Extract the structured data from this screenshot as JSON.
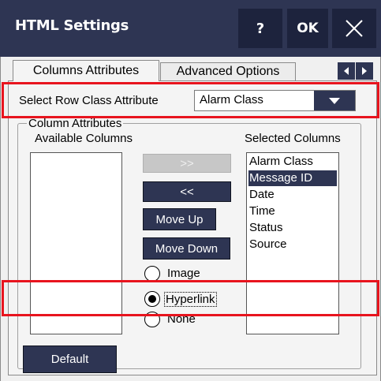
{
  "window": {
    "title": "HTML Settings",
    "help_label": "?",
    "ok_label": "OK"
  },
  "tabs": [
    {
      "label": "Columns Attributes",
      "active": true
    },
    {
      "label": "Advanced Options",
      "active": false
    }
  ],
  "row_class": {
    "label": "Select Row Class Attribute",
    "value": "Alarm Class"
  },
  "column_attributes": {
    "group_label": "Column Attributes",
    "available_label": "Available Columns",
    "selected_label": "Selected Columns",
    "available_items": [],
    "selected_items": [
      "Alarm Class",
      "Message ID",
      "Date",
      "Time",
      "Status",
      "Source"
    ],
    "selected_highlight": "Message ID"
  },
  "buttons": {
    "add": ">>",
    "remove": "<<",
    "move_up": "Move Up",
    "move_down": "Move Down",
    "default": "Default"
  },
  "radio_options": [
    {
      "label": "Image",
      "checked": false
    },
    {
      "label": "Hyperlink",
      "checked": true
    },
    {
      "label": "None",
      "checked": false
    }
  ],
  "colors": {
    "accent": "#2e3553",
    "highlight_box": "#e8141e"
  }
}
